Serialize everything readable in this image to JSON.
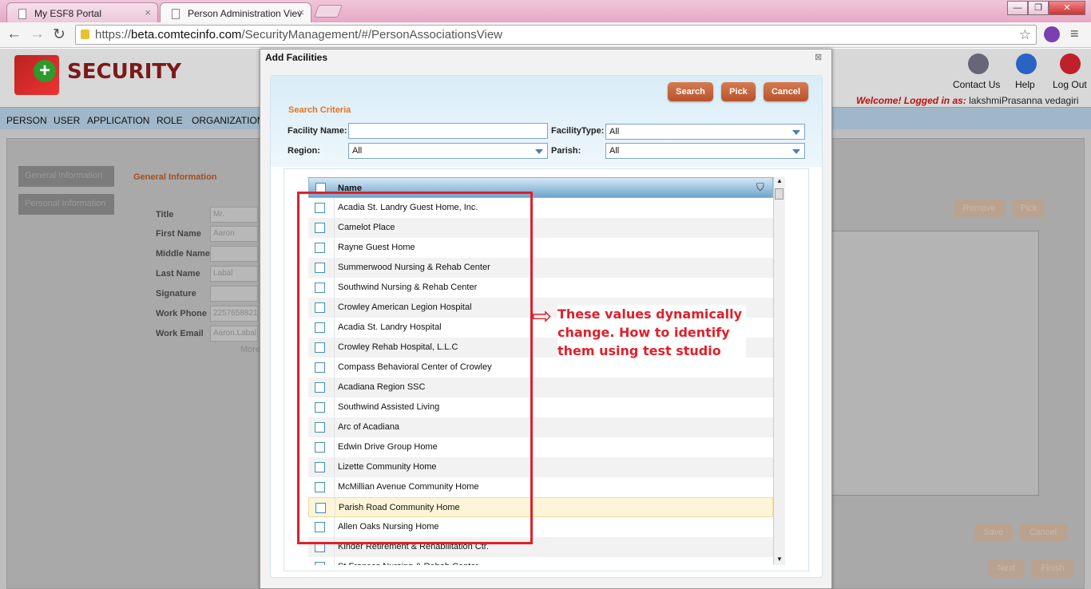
{
  "browser": {
    "tabs": [
      {
        "label": "My ESF8 Portal"
      },
      {
        "label": "Person Administration Viev"
      }
    ],
    "url_scheme": "https://",
    "url_host": "beta.comtecinfo.com",
    "url_path": "/SecurityManagement/#/PersonAssociationsView"
  },
  "app": {
    "title": "SECURITY",
    "top_links": [
      "Contact Us",
      "Help",
      "Log Out"
    ],
    "welcome_prefix": "Welcome! Logged in as:",
    "welcome_user": "lakshmiPrasanna vedagiri",
    "menu": [
      "PERSON",
      "USER",
      "APPLICATION",
      "ROLE",
      "ORGANIZATION"
    ],
    "side_tabs": [
      "General Information",
      "Personal Information"
    ],
    "section_title": "General Information",
    "fields": [
      {
        "label": "Title",
        "value": "Mr."
      },
      {
        "label": "First Name",
        "value": "Aaron"
      },
      {
        "label": "Middle Name",
        "value": ""
      },
      {
        "label": "Last Name",
        "value": "Labal"
      },
      {
        "label": "Signature",
        "value": ""
      },
      {
        "label": "Work Phone",
        "value": "2257658821"
      },
      {
        "label": "Work Email",
        "value": "Aaron.Labal"
      }
    ],
    "more_label": "More",
    "bg_buttons": {
      "remove": "Remove",
      "pick": "Pick",
      "save": "Save",
      "cancel": "Cancel",
      "next": "Next",
      "finish": "Finish"
    }
  },
  "modal": {
    "title": "Add Facilities",
    "buttons": {
      "search": "Search",
      "pick": "Pick",
      "cancel": "Cancel"
    },
    "criteria_label": "Search Criteria",
    "facility_name_label": "Facility Name:",
    "facility_name_value": "",
    "facility_type_label": "FacilityType:",
    "facility_type_value": "All",
    "region_label": "Region:",
    "region_value": "All",
    "parish_label": "Parish:",
    "parish_value": "All",
    "grid_header": "Name",
    "rows": [
      "Acadia St. Landry Guest Home, Inc.",
      "Camelot Place",
      "Rayne Guest Home",
      "Summerwood Nursing & Rehab Center",
      "Southwind Nursing & Rehab Center",
      "Crowley  American Legion Hospital",
      "Acadia St. Landry Hospital",
      "Crowley Rehab Hospital, L.L.C",
      "Compass Behavioral Center of Crowley",
      "Acadiana Region SSC",
      "Southwind Assisted Living",
      "Arc of Acadiana",
      "Edwin Drive Group Home",
      "Lizette Community Home",
      "McMillian Avenue Community Home",
      "Parish Road Community Home",
      "Allen Oaks Nursing Home",
      "Kinder Retirement & Rehabilitation Ctr.",
      "St Frances Nursing & Rehab Center"
    ],
    "highlighted_row": 15
  },
  "annotation": {
    "note": "These values dynamically change. How to identify them using test studio"
  },
  "colors": {
    "accent_orange": "#c0603a",
    "annotation_red": "#e0202a",
    "grid_header_blue": "#6fa4cc"
  }
}
